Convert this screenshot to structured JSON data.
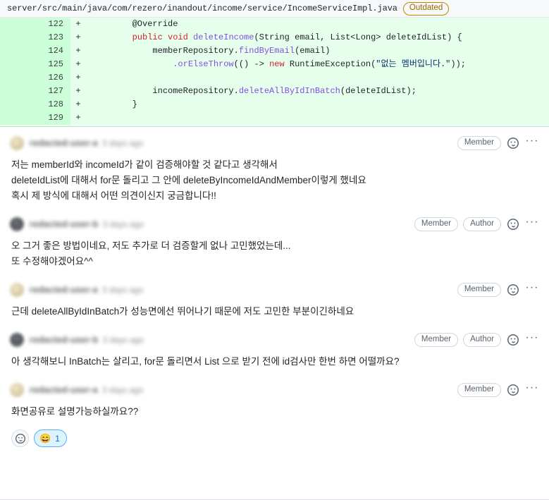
{
  "file_header": {
    "path": "server/src/main/java/com/rezero/inandout/income/service/IncomeServiceImpl.java",
    "outdated_badge": "Outdated"
  },
  "diff": {
    "rows": [
      {
        "line": "122",
        "marker": "+",
        "tokens": [
          {
            "t": "        ",
            "c": "pl"
          },
          {
            "t": "@Override",
            "c": "an"
          }
        ]
      },
      {
        "line": "123",
        "marker": "+",
        "tokens": [
          {
            "t": "        ",
            "c": "pl"
          },
          {
            "t": "public",
            "c": "k"
          },
          {
            "t": " ",
            "c": "pl"
          },
          {
            "t": "void",
            "c": "k"
          },
          {
            "t": " ",
            "c": "pl"
          },
          {
            "t": "deleteIncome",
            "c": "fn"
          },
          {
            "t": "(String email, List<Long> deleteIdList) {",
            "c": "pl"
          }
        ]
      },
      {
        "line": "124",
        "marker": "+",
        "tokens": [
          {
            "t": "            memberRepository.",
            "c": "pl"
          },
          {
            "t": "findByEmail",
            "c": "fn"
          },
          {
            "t": "(email)",
            "c": "pl"
          }
        ]
      },
      {
        "line": "125",
        "marker": "+",
        "tokens": [
          {
            "t": "                ",
            "c": "pl"
          },
          {
            "t": ".orElseThrow",
            "c": "fn"
          },
          {
            "t": "(() -> ",
            "c": "pl"
          },
          {
            "t": "new",
            "c": "k"
          },
          {
            "t": " RuntimeException(",
            "c": "pl"
          },
          {
            "t": "\"없는 멤버입니다.\"",
            "c": "st"
          },
          {
            "t": "));",
            "c": "pl"
          }
        ]
      },
      {
        "line": "126",
        "marker": "+",
        "tokens": [
          {
            "t": "",
            "c": "pl"
          }
        ]
      },
      {
        "line": "127",
        "marker": "+",
        "tokens": [
          {
            "t": "            incomeRepository.",
            "c": "pl"
          },
          {
            "t": "deleteAllByIdInBatch",
            "c": "fn"
          },
          {
            "t": "(deleteIdList);",
            "c": "pl"
          }
        ]
      },
      {
        "line": "128",
        "marker": "+",
        "tokens": [
          {
            "t": "        }",
            "c": "pl"
          }
        ]
      },
      {
        "line": "129",
        "marker": "+",
        "tokens": [
          {
            "t": "",
            "c": "pl"
          }
        ]
      }
    ]
  },
  "comments": [
    {
      "avatar_tone": "light",
      "author": "redacted-user-a",
      "timestamp": "3 days ago",
      "badges": [
        "Member"
      ],
      "body": "저는 memberId와 incomeId가 같이 검증해야할 것 같다고 생각해서\ndeleteIdList에 대해서 for문 돌리고 그 안에 deleteByIncomeIdAndMember이렇게 했네요\n혹시 제 방식에 대해서 어떤 의견이신지 궁금합니다!!",
      "reactions": []
    },
    {
      "avatar_tone": "dark",
      "author": "redacted-user-b",
      "timestamp": "3 days ago",
      "badges": [
        "Member",
        "Author"
      ],
      "body": "오 그거 좋은 방법이네요, 저도 추가로 더 검증할게 없나 고민했었는데...\n또 수정해야겠어요^^",
      "reactions": []
    },
    {
      "avatar_tone": "light",
      "author": "redacted-user-a",
      "timestamp": "3 days ago",
      "badges": [
        "Member"
      ],
      "body": "근데 deleteAllByIdInBatch가 성능면에선 뛰어나기 때문에 저도 고민한 부분이긴하네요",
      "reactions": []
    },
    {
      "avatar_tone": "dark",
      "author": "redacted-user-b",
      "timestamp": "3 days ago",
      "badges": [
        "Member",
        "Author"
      ],
      "body": "아 생각해보니 InBatch는 살리고, for문 돌리면서 List 으로 받기 전에 id검사만 한번 하면 어떨까요?",
      "reactions": []
    },
    {
      "avatar_tone": "light",
      "author": "redacted-user-a",
      "timestamp": "3 days ago",
      "badges": [
        "Member"
      ],
      "body": "화면공유로 설명가능하실까요??",
      "reactions": [
        {
          "emoji": "😄",
          "name": "laugh-reaction",
          "count": "1",
          "active": true
        }
      ]
    }
  ],
  "icons": {
    "add_reaction": "smiley-icon",
    "more_options": "kebab-menu-icon"
  },
  "colors": {
    "diff_add_bg": "#e6ffec",
    "diff_add_gutter": "#ccffd8",
    "outdated_border": "#bf8700",
    "outdated_text": "#9a6700",
    "reaction_active_bg": "#ddf4ff",
    "reaction_active_border": "#54aeff",
    "keyword": "#cf222e",
    "function": "#8250df",
    "string": "#0a3069"
  }
}
